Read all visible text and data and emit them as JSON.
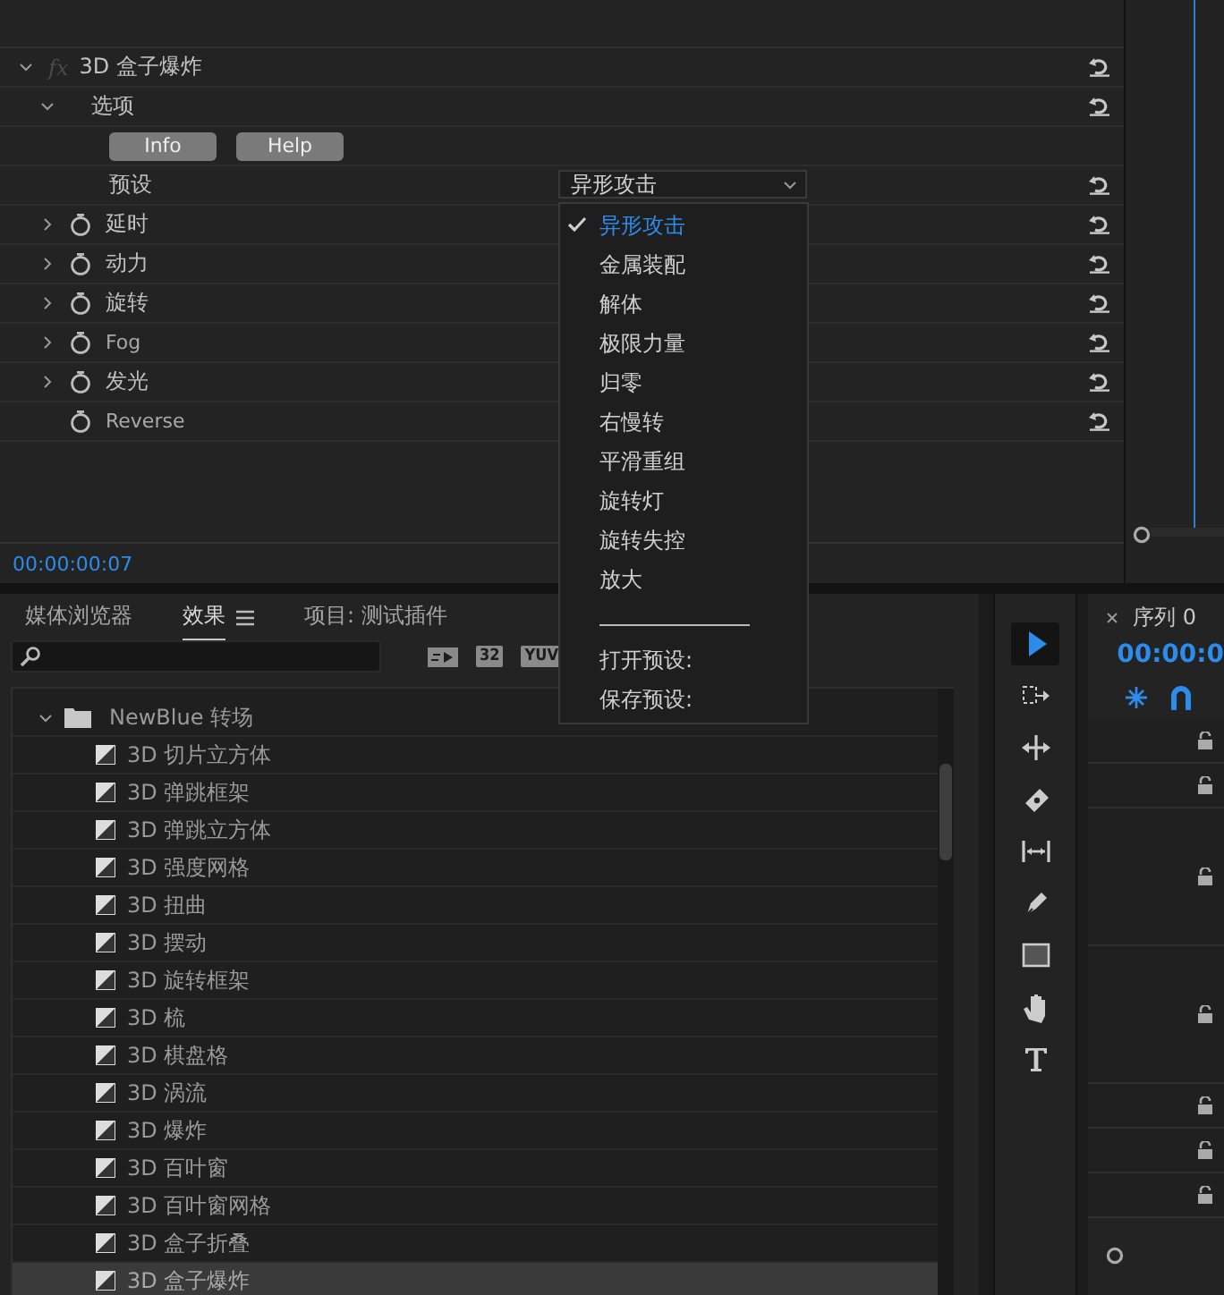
{
  "effect_controls": {
    "effect": {
      "fx_label": "fx",
      "name": "3D 盒子爆炸",
      "expanded": true
    },
    "rows": [
      {
        "kind": "group",
        "label": "选项",
        "expanded": true
      },
      {
        "kind": "buttons",
        "buttons": [
          "Info",
          "Help"
        ]
      },
      {
        "kind": "dropdown",
        "label": "预设",
        "value": "异形攻击"
      },
      {
        "kind": "param",
        "label": "延时",
        "expandable": true
      },
      {
        "kind": "param",
        "label": "动力",
        "expandable": true
      },
      {
        "kind": "param",
        "label": "旋转",
        "expandable": true
      },
      {
        "kind": "param",
        "label": "Fog",
        "expandable": true
      },
      {
        "kind": "param",
        "label": "发光",
        "expandable": true
      },
      {
        "kind": "param",
        "label": "Reverse",
        "expandable": false
      }
    ],
    "timecode": "00:00:00:07"
  },
  "preset_menu": {
    "items": [
      {
        "kind": "option",
        "label": "异形攻击",
        "selected": true
      },
      {
        "kind": "option",
        "label": "金属装配",
        "selected": false
      },
      {
        "kind": "option",
        "label": "解体",
        "selected": false
      },
      {
        "kind": "option",
        "label": "极限力量",
        "selected": false
      },
      {
        "kind": "option",
        "label": "归零",
        "selected": false
      },
      {
        "kind": "option",
        "label": "右慢转",
        "selected": false
      },
      {
        "kind": "option",
        "label": "平滑重组",
        "selected": false
      },
      {
        "kind": "option",
        "label": "旋转灯",
        "selected": false
      },
      {
        "kind": "option",
        "label": "旋转失控",
        "selected": false
      },
      {
        "kind": "option",
        "label": "放大",
        "selected": false
      },
      {
        "kind": "separator"
      },
      {
        "kind": "action",
        "label": "打开预设:"
      },
      {
        "kind": "action",
        "label": "保存预设:"
      }
    ]
  },
  "effects_panel": {
    "tabs": [
      {
        "label": "媒体浏览器",
        "selected": false
      },
      {
        "label": "效果",
        "selected": true
      },
      {
        "label": "项目: 测试插件",
        "selected": false
      }
    ],
    "badges": [
      "32",
      "YUV"
    ],
    "folder": {
      "label": "NewBlue 转场",
      "expanded": true,
      "children": [
        {
          "label": "3D 切片立方体",
          "selected": false
        },
        {
          "label": "3D 弹跳框架",
          "selected": false
        },
        {
          "label": "3D 弹跳立方体",
          "selected": false
        },
        {
          "label": "3D 强度网格",
          "selected": false
        },
        {
          "label": "3D 扭曲",
          "selected": false
        },
        {
          "label": "3D 摆动",
          "selected": false
        },
        {
          "label": "3D 旋转框架",
          "selected": false
        },
        {
          "label": "3D 梳",
          "selected": false
        },
        {
          "label": "3D 棋盘格",
          "selected": false
        },
        {
          "label": "3D 涡流",
          "selected": false
        },
        {
          "label": "3D 爆炸",
          "selected": false
        },
        {
          "label": "3D 百叶窗",
          "selected": false
        },
        {
          "label": "3D 百叶窗网格",
          "selected": false
        },
        {
          "label": "3D 盒子折叠",
          "selected": false
        },
        {
          "label": "3D 盒子爆炸",
          "selected": true
        }
      ]
    }
  },
  "tools": [
    {
      "kind": "select",
      "selected": true
    },
    {
      "kind": "track-select",
      "selected": false
    },
    {
      "kind": "ripple",
      "selected": false
    },
    {
      "kind": "razor",
      "selected": false
    },
    {
      "kind": "slip",
      "selected": false
    },
    {
      "kind": "pen",
      "selected": false
    },
    {
      "kind": "rect",
      "selected": false
    },
    {
      "kind": "hand",
      "selected": false
    },
    {
      "kind": "type",
      "selected": false
    }
  ],
  "timeline": {
    "title": "序列 0",
    "timecode": "00:00:0",
    "tracks": [
      {
        "kind": "small"
      },
      {
        "kind": "small"
      },
      {
        "kind": "tall"
      },
      {
        "kind": "tall"
      },
      {
        "kind": "small"
      },
      {
        "kind": "small"
      },
      {
        "kind": "small"
      }
    ]
  }
}
